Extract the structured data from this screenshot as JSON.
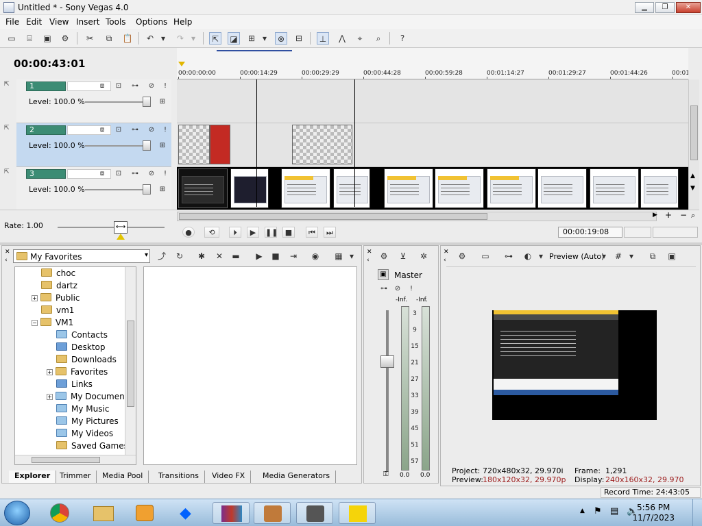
{
  "window": {
    "title": "Untitled * - Sony Vegas 4.0"
  },
  "menu": [
    "File",
    "Edit",
    "View",
    "Insert",
    "Tools",
    "Options",
    "Help"
  ],
  "timeline": {
    "timecode": "00:00:43:01",
    "ruler": [
      "00:00:00:00",
      "00:00:14:29",
      "00:00:29:29",
      "00:00:44:28",
      "00:00:59:28",
      "00:01:14:27",
      "00:01:29:27",
      "00:01:44:26",
      "00:01"
    ],
    "tracks": [
      {
        "num": "1",
        "level": "Level: 100.0 %"
      },
      {
        "num": "2",
        "level": "Level: 100.0 %"
      },
      {
        "num": "3",
        "level": "Level: 100.0 %"
      }
    ],
    "rate": "Rate: 1.00",
    "cursor_time": "00:00:19:08"
  },
  "explorer": {
    "location": "My Favorites",
    "tree": [
      "choc",
      "dartz",
      "Public",
      "vm1",
      "VM1",
      "Contacts",
      "Desktop",
      "Downloads",
      "Favorites",
      "Links",
      "My Documents",
      "My Music",
      "My Pictures",
      "My Videos",
      "Saved Games"
    ],
    "tabs": [
      "Explorer",
      "Trimmer",
      "Media Pool",
      "Transitions",
      "Video FX",
      "Media Generators"
    ]
  },
  "mixer": {
    "title": "Master",
    "inf_left": "-Inf.",
    "inf_right": "-Inf.",
    "scale": [
      "3",
      "9",
      "15",
      "21",
      "27",
      "33",
      "39",
      "45",
      "51",
      "57"
    ],
    "bottom_left": "0.0",
    "bottom_right": "0.0"
  },
  "preview": {
    "mode": "Preview (Auto)",
    "project_label": "Project:",
    "project_value": "720x480x32, 29.970i",
    "preview_label": "Preview:",
    "preview_value": "180x120x32, 29.970p",
    "frame_label": "Frame:",
    "frame_value": "1,291",
    "display_label": "Display:",
    "display_value": "240x160x32, 29.970",
    "record_time": "Record Time: 24:43:05"
  },
  "taskbar": {
    "time": "5:56 PM",
    "date": "11/7/2023"
  },
  "colors": {
    "track_number": "#3c8c74",
    "selected_track": "#c4d9f0",
    "red_clip": "#c32a23",
    "taskbar": "#98bbda"
  }
}
